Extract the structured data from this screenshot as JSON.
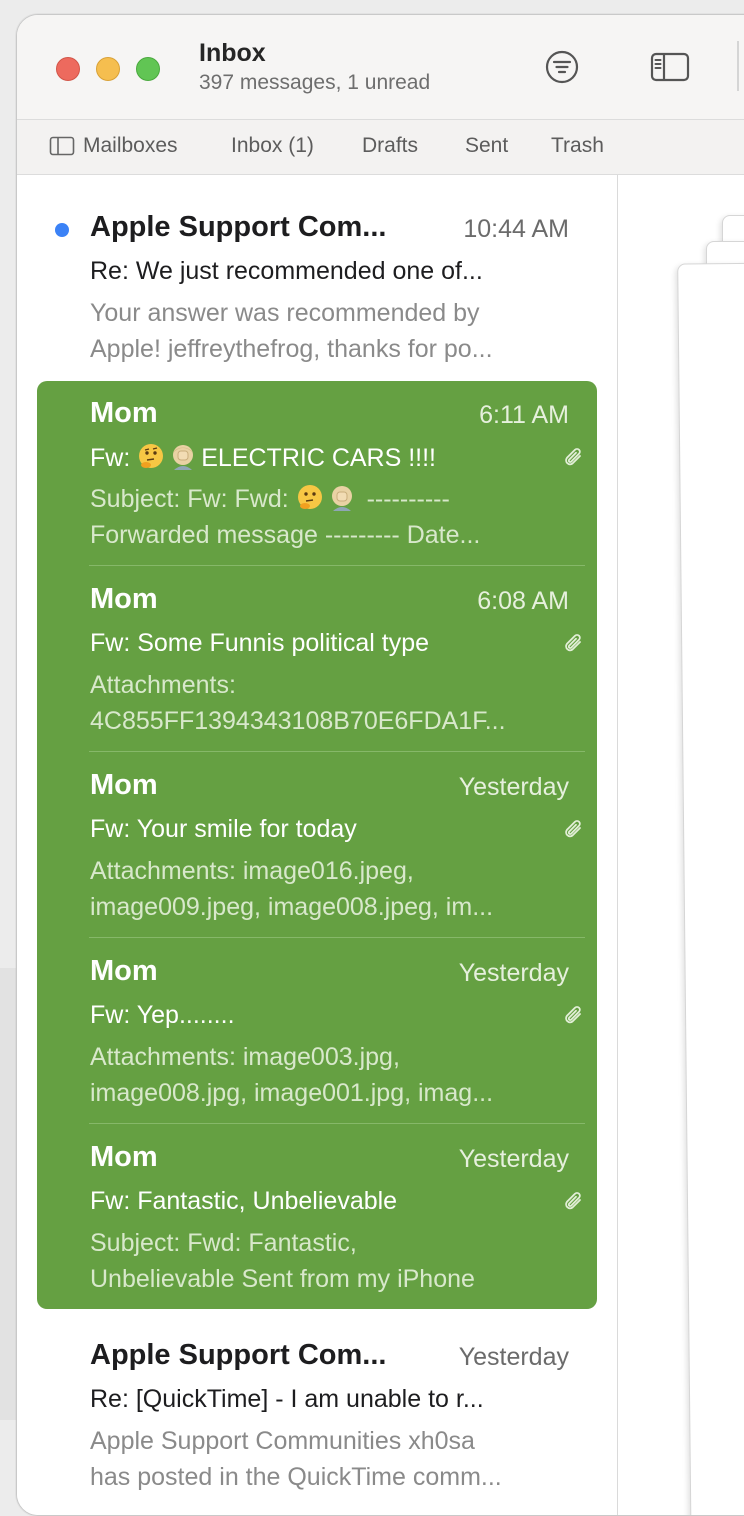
{
  "window": {
    "title": "Inbox",
    "subtitle": "397 messages, 1 unread"
  },
  "favorites": {
    "mailboxes": "Mailboxes",
    "inbox": "Inbox (1)",
    "drafts": "Drafts",
    "sent": "Sent",
    "trash": "Trash"
  },
  "colors": {
    "selection": "#65a042",
    "unread_dot": "#3b82f6"
  },
  "messages": [
    {
      "sender": "Apple Support Com...",
      "time": "10:44 AM",
      "subject": "Re:  We just recommended one of...",
      "preview_line1": "Your answer was recommended by",
      "preview_line2": "Apple! jeffreythefrog, thanks for po...",
      "unread": true
    },
    {
      "sender": "Mom",
      "time": "6:11 AM",
      "subject_prefix": "Fw:",
      "subject_text": "ELECTRIC CARS !!!!",
      "subject_emojis": [
        "thinking-face",
        "facepalm"
      ],
      "preview_prefix": "Subject: Fw: Fwd:",
      "preview_suffix": "----------",
      "preview_line2": "Forwarded message --------- Date...",
      "attachment": true
    },
    {
      "sender": "Mom",
      "time": "6:08 AM",
      "subject": "Fw: Some Funnis political type",
      "preview_line1": "Attachments:",
      "preview_line2": "4C855FF1394343108B70E6FDA1F...",
      "attachment": true
    },
    {
      "sender": "Mom",
      "time": "Yesterday",
      "subject": "Fw: Your smile for today",
      "preview_line1": "Attachments: image016.jpeg,",
      "preview_line2": "image009.jpeg, image008.jpeg, im...",
      "attachment": true
    },
    {
      "sender": "Mom",
      "time": "Yesterday",
      "subject": "Fw: Yep........",
      "preview_line1": "Attachments: image003.jpg,",
      "preview_line2": "image008.jpg, image001.jpg, imag...",
      "attachment": true
    },
    {
      "sender": "Mom",
      "time": "Yesterday",
      "subject": "Fw: Fantastic, Unbelievable",
      "preview_line1": "Subject: Fwd: Fantastic,",
      "preview_line2": "Unbelievable Sent from my iPhone",
      "attachment": true
    },
    {
      "sender": "Apple Support Com...",
      "time": "Yesterday",
      "subject": "Re: [QuickTime] - I am unable to r...",
      "preview_line1": "Apple Support Communities xh0sa",
      "preview_line2": "has posted in the QuickTime comm..."
    }
  ]
}
